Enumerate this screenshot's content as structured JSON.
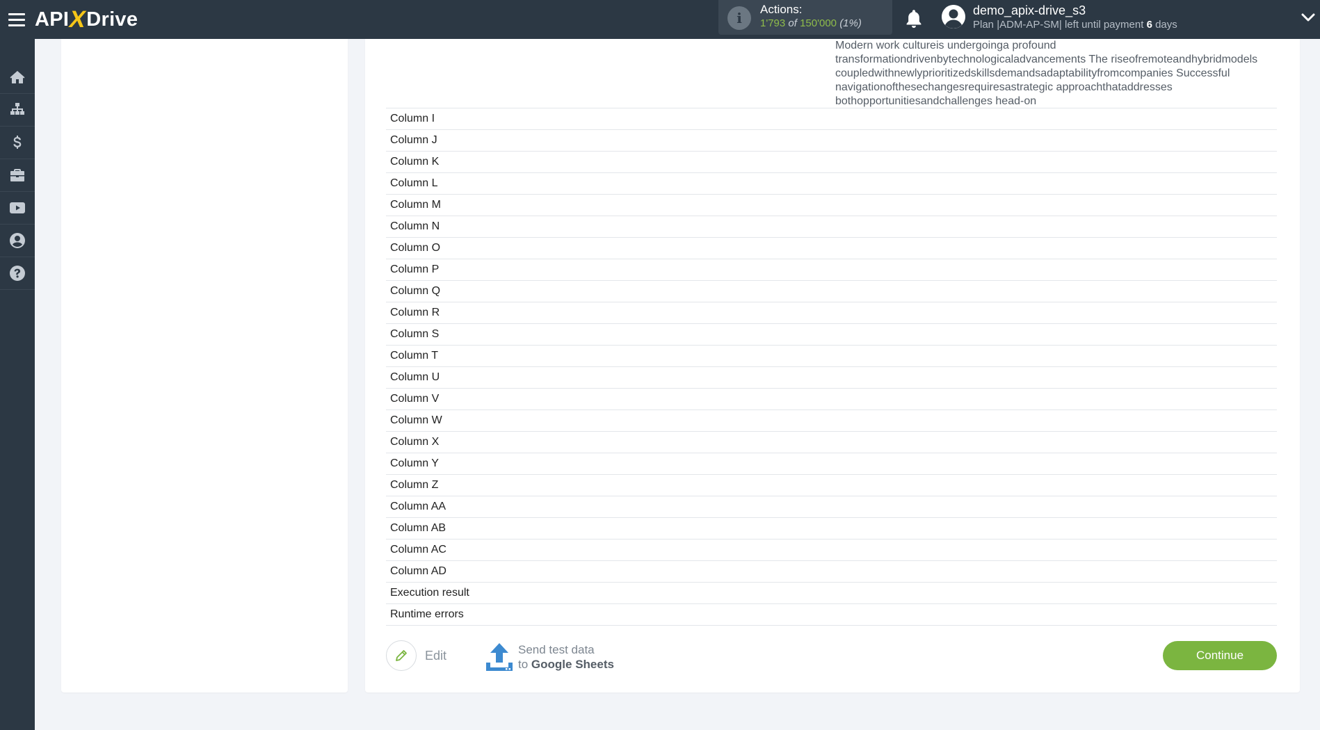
{
  "header": {
    "logo_left": "API",
    "logo_x": "X",
    "logo_right": "Drive",
    "actions_label": "Actions:",
    "actions_used": "1'793",
    "actions_of": "of",
    "actions_total": "150'000",
    "actions_percent": "(1%)",
    "user_name": "demo_apix-drive_s3",
    "plan_text": "Plan |ADM-AP-SM| left until payment",
    "plan_days": "6",
    "plan_days_unit": "days"
  },
  "sidebar": {
    "items": [
      "home-icon",
      "sitemap-icon",
      "dollar-icon",
      "briefcase-icon",
      "video-icon",
      "user-icon",
      "help-icon"
    ]
  },
  "main": {
    "body_text": "Modern work cultureis undergoinga profound transformationdrivenbytechnologicaladvancements The riseofremoteandhybridmodels coupledwithnewlyprioritizedskillsdemandsadaptabilityfromcompanies Successful navigationofthesechangesrequiresastrategic approachthataddresses bothopportunitiesandchallenges head-on",
    "rows": [
      "Column I",
      "Column J",
      "Column K",
      "Column L",
      "Column M",
      "Column N",
      "Column O",
      "Column P",
      "Column Q",
      "Column R",
      "Column S",
      "Column T",
      "Column U",
      "Column V",
      "Column W",
      "Column X",
      "Column Y",
      "Column Z",
      "Column AA",
      "Column AB",
      "Column AC",
      "Column AD",
      "Execution result",
      "Runtime errors"
    ]
  },
  "footer": {
    "edit_label": "Edit",
    "send_line1": "Send test data",
    "send_to": "to",
    "send_target": "Google Sheets",
    "continue_label": "Continue"
  },
  "colors": {
    "header_bg": "#2c3844",
    "accent_green": "#7bb540",
    "logo_x_yellow": "#f5c518",
    "upload_blue": "#3d8ad0"
  }
}
